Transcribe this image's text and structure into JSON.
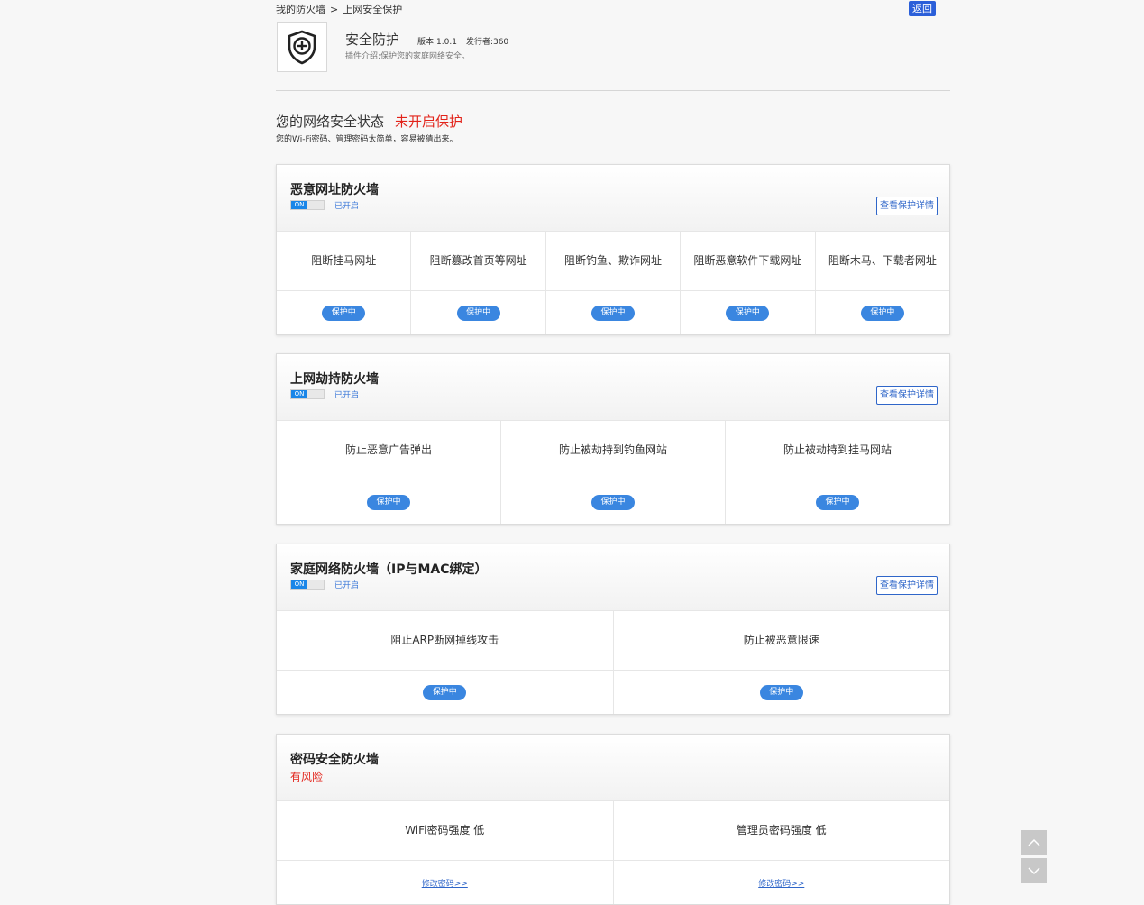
{
  "breadcrumb": {
    "parent": "我的防火墙",
    "separator": ">",
    "current": "上网安全保护"
  },
  "back_label": "返回",
  "plugin": {
    "icon": "shield-plus-icon",
    "name": "安全防护",
    "version": "版本:1.0.1",
    "publisher": "发行者:360",
    "description": "插件介绍:保护您的家庭网络安全。"
  },
  "status": {
    "title": "您的网络安全状态",
    "state": "未开启保护",
    "state_color": "#e2231a",
    "subtitle": "您的Wi-Fi密码、管理密码太简单，容易被猜出来。"
  },
  "accent_color": "#3a86e0",
  "panels": [
    {
      "title": "恶意网址防火墙",
      "toggle": "ON",
      "toggle_label": "已开启",
      "detail_label": "查看保护详情",
      "items": [
        {
          "label": "阻断挂马网址",
          "status": "保护中"
        },
        {
          "label": "阻断篡改首页等网址",
          "status": "保护中"
        },
        {
          "label": "阻断钓鱼、欺诈网址",
          "status": "保护中"
        },
        {
          "label": "阻断恶意软件下载网址",
          "status": "保护中"
        },
        {
          "label": "阻断木马、下载者网址",
          "status": "保护中"
        }
      ]
    },
    {
      "title": "上网劫持防火墙",
      "toggle": "ON",
      "toggle_label": "已开启",
      "detail_label": "查看保护详情",
      "items": [
        {
          "label": "防止恶意广告弹出",
          "status": "保护中"
        },
        {
          "label": "防止被劫持到钓鱼网站",
          "status": "保护中"
        },
        {
          "label": "防止被劫持到挂马网站",
          "status": "保护中"
        }
      ]
    },
    {
      "title": "家庭网络防火墙（IP与MAC绑定）",
      "toggle": "ON",
      "toggle_label": "已开启",
      "detail_label": "查看保护详情",
      "items": [
        {
          "label": "阻止ARP断网掉线攻击",
          "status": "保护中"
        },
        {
          "label": "防止被恶意限速",
          "status": "保护中"
        }
      ]
    },
    {
      "title": "密码安全防火墙",
      "risk_label": "有风险",
      "items": [
        {
          "label": "WiFi密码强度 低",
          "link": "修改密码>>"
        },
        {
          "label": "管理员密码强度 低",
          "link": "修改密码>>"
        }
      ]
    }
  ],
  "scroll": {
    "up_icon": "chevron-up-icon",
    "down_icon": "chevron-down-icon"
  }
}
